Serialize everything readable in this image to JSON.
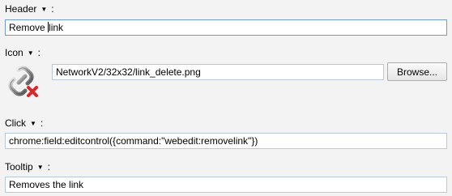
{
  "header": {
    "label": "Header",
    "arrow": "▼",
    "colon": ":",
    "value_before_caret": "Remove ",
    "value_after_caret": "link"
  },
  "icon": {
    "label": "Icon",
    "arrow": "▼",
    "colon": ":",
    "image_name": "link-delete-icon",
    "path_value": "NetworkV2/32x32/link_delete.png",
    "browse_label": "Browse..."
  },
  "click": {
    "label": "Click",
    "arrow": "▼",
    "colon": ":",
    "value": "chrome:field:editcontrol({command:\"webedit:removelink\"})"
  },
  "tooltip": {
    "label": "Tooltip",
    "arrow": "▼",
    "colon": ":",
    "value": "Removes the link"
  },
  "colors": {
    "background": "#f3f3f3",
    "field_border": "#b9c9dc",
    "focused_border": "#6f9ccf",
    "delete_mark": "#d9262b"
  }
}
